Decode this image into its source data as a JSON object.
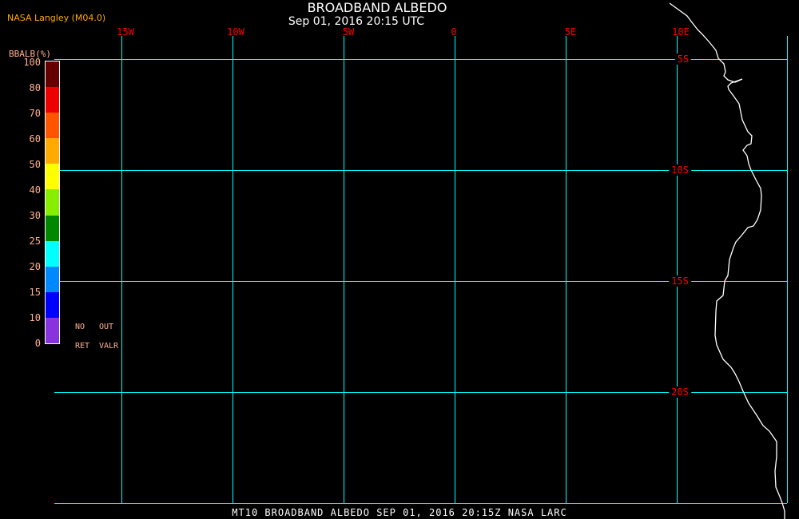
{
  "title": "BROADBAND ALBEDO",
  "subtitle": "Sep 01, 2016 20:15 UTC",
  "credit": "NASA Langley (M04.0)",
  "footer": "MT10  BROADBAND ALBEDO   SEP 01, 2016 20:15Z   NASA LARC",
  "map": {
    "longitude_labels": [
      "15W",
      "10W",
      "5W",
      "0",
      "5E",
      "10E"
    ],
    "latitude_labels": [
      "5S",
      "10S",
      "15S",
      "20S"
    ],
    "grid_color": "#00ffff",
    "coastline_color": "#ffffff",
    "label_color": "#ff0000"
  },
  "colorbar": {
    "title": "BBALB(%)",
    "labels": [
      "100",
      "80",
      "70",
      "60",
      "50",
      "40",
      "30",
      "25",
      "20",
      "15",
      "10",
      "0"
    ],
    "colors": [
      "#660000",
      "#ee0000",
      "#ff5500",
      "#ffaa00",
      "#ffff00",
      "#88ee00",
      "#008800",
      "#00ffff",
      "#0088ff",
      "#0000ff",
      "#8833dd"
    ],
    "notes": [
      "NO",
      "OUT",
      "RET",
      "VALR"
    ]
  }
}
